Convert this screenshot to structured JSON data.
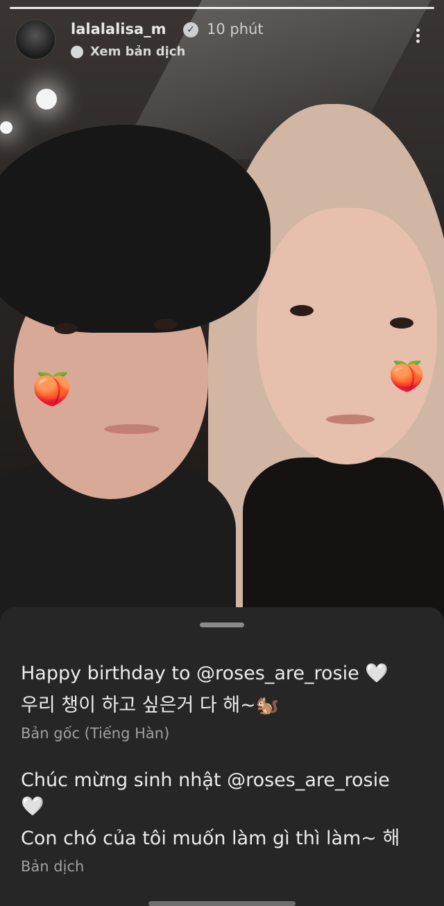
{
  "header": {
    "username": "lalalalisa_m",
    "time": "10 phút",
    "translate_label": "Xem bản dịch"
  },
  "icons": {
    "verified": "verified-badge-icon",
    "translate": "translate-icon",
    "more": "more-vertical-icon",
    "peach": "🍑"
  },
  "caption": {
    "original_line1": "Happy birthday to @roses_are_rosie 🤍",
    "original_line2": "우리 챙이 하고 싶은거 다 해~🐿️",
    "original_label": "Bản gốc (Tiếng Hàn)",
    "translated_line1": "Chúc mừng sinh nhật @roses_are_rosie",
    "translated_heart": "🤍",
    "translated_line2": "Con chó của tôi muốn làm gì thì làm~ 해",
    "translated_label": "Bản dịch"
  },
  "colors": {
    "sheet_bg": "#262626",
    "text_primary": "#ececec",
    "text_secondary": "#a0a0a0"
  }
}
